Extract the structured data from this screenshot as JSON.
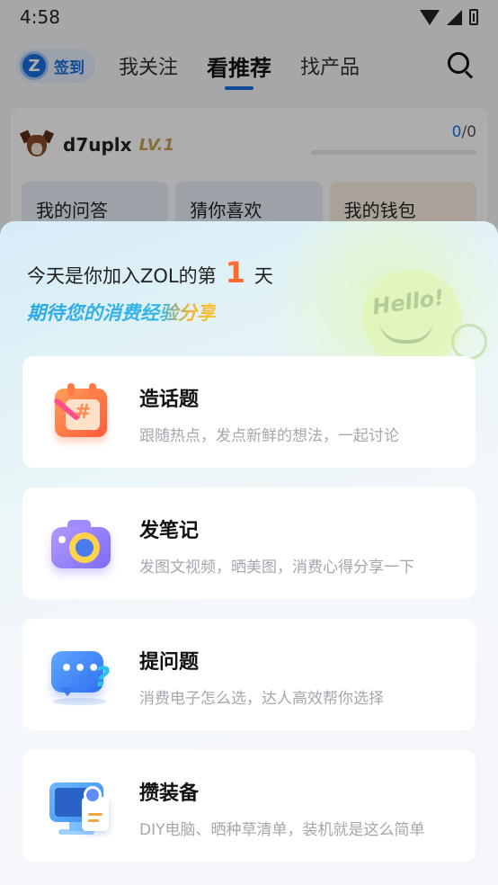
{
  "statusbar": {
    "time": "4:58"
  },
  "topnav": {
    "signin_label": "签到",
    "signin_logo": "Z",
    "tabs": [
      {
        "label": "我关注",
        "active": false
      },
      {
        "label": "看推荐",
        "active": true
      },
      {
        "label": "找产品",
        "active": false
      }
    ]
  },
  "profile": {
    "username": "d7uplx",
    "level": "LV.1",
    "progress_current": "0",
    "progress_total": "/0",
    "progress_fraction": 0,
    "shortcuts": [
      "我的问答",
      "猜你喜欢",
      "我的钱包"
    ]
  },
  "sheet": {
    "greeting_prefix": "今天是你加入ZOL的第",
    "greeting_days": "1",
    "greeting_suffix": "天",
    "slogan": "期待您的消费经验分享",
    "hello_text": "Hello!",
    "actions": [
      {
        "title": "造话题",
        "subtitle": "跟随热点，发点新鲜的想法，一起讨论",
        "icon": "calendar-topic-icon"
      },
      {
        "title": "发笔记",
        "subtitle": "发图文视频，晒美图，消费心得分享一下",
        "icon": "camera-note-icon"
      },
      {
        "title": "提问题",
        "subtitle": "消费电子怎么选，达人高效帮你选择",
        "icon": "chat-question-icon"
      },
      {
        "title": "攒装备",
        "subtitle": "DIY电脑、晒种草清单，装机就是这么简单",
        "icon": "monitor-gear-icon"
      }
    ]
  },
  "colors": {
    "accent_blue": "#1a6fe0",
    "day_orange": "#ff6a30",
    "slogan_blue": "#2ea9e6",
    "slogan_gold": "#f7c43c"
  }
}
